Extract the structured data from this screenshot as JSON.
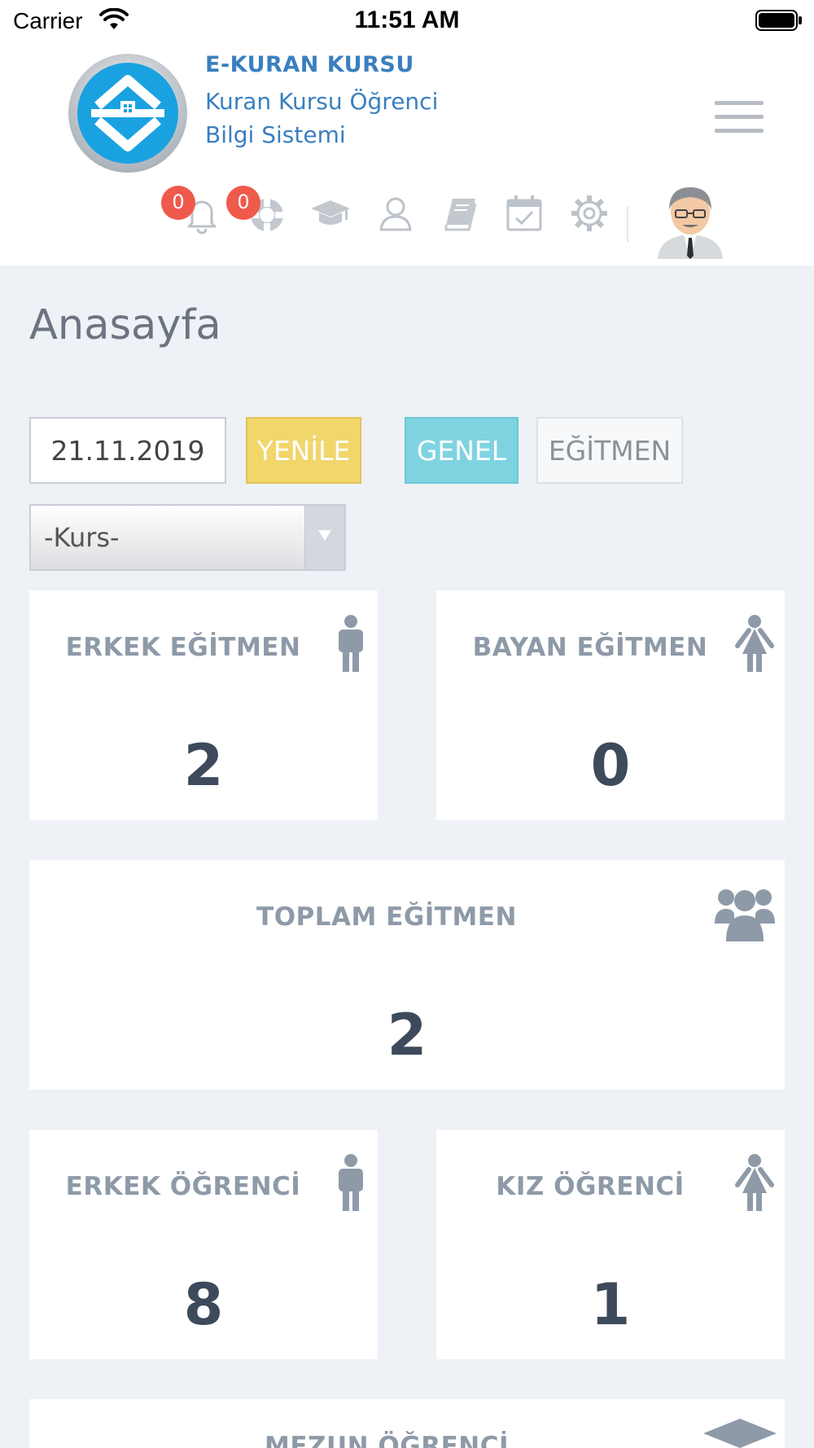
{
  "status_bar": {
    "carrier": "Carrier",
    "time": "11:51 AM"
  },
  "header": {
    "title": "E-KURAN KURSU",
    "subtitle": "Kuran Kursu Öğrenci Bilgi Sistemi",
    "badges": {
      "notifications": "0",
      "support": "0"
    }
  },
  "page": {
    "title": "Anasayfa"
  },
  "filters": {
    "date": "21.11.2019",
    "refresh_label": "YENİLE",
    "general_label": "GENEL",
    "teacher_label": "EĞİTMEN",
    "course_select": "-Kurs-"
  },
  "stats": {
    "male_teacher": {
      "label": "ERKEK EĞİTMEN",
      "value": "2"
    },
    "female_teacher": {
      "label": "BAYAN EĞİTMEN",
      "value": "0"
    },
    "total_teacher": {
      "label": "TOPLAM EĞİTMEN",
      "value": "2"
    },
    "male_student": {
      "label": "ERKEK ÖĞRENCİ",
      "value": "8"
    },
    "female_student": {
      "label": "KIZ ÖĞRENCİ",
      "value": "1"
    },
    "graduate_student": {
      "label": "MEZUN ÖĞRENCİ"
    }
  },
  "colors": {
    "brand": "#3a7fc0",
    "badge": "#ef5a4c",
    "refresh": "#f0d66b",
    "general": "#7fd3e0",
    "stat_label": "#8e9aa8",
    "stat_value": "#3d4a5b",
    "background": "#eef1f5"
  },
  "icons": [
    "wifi-icon",
    "battery-icon",
    "logo-icon",
    "menu-icon",
    "bell-icon",
    "lifebuoy-icon",
    "graduation-cap-icon",
    "user-icon",
    "book-icon",
    "calendar-check-icon",
    "gear-icon",
    "avatar",
    "male-icon",
    "female-icon",
    "group-icon"
  ]
}
